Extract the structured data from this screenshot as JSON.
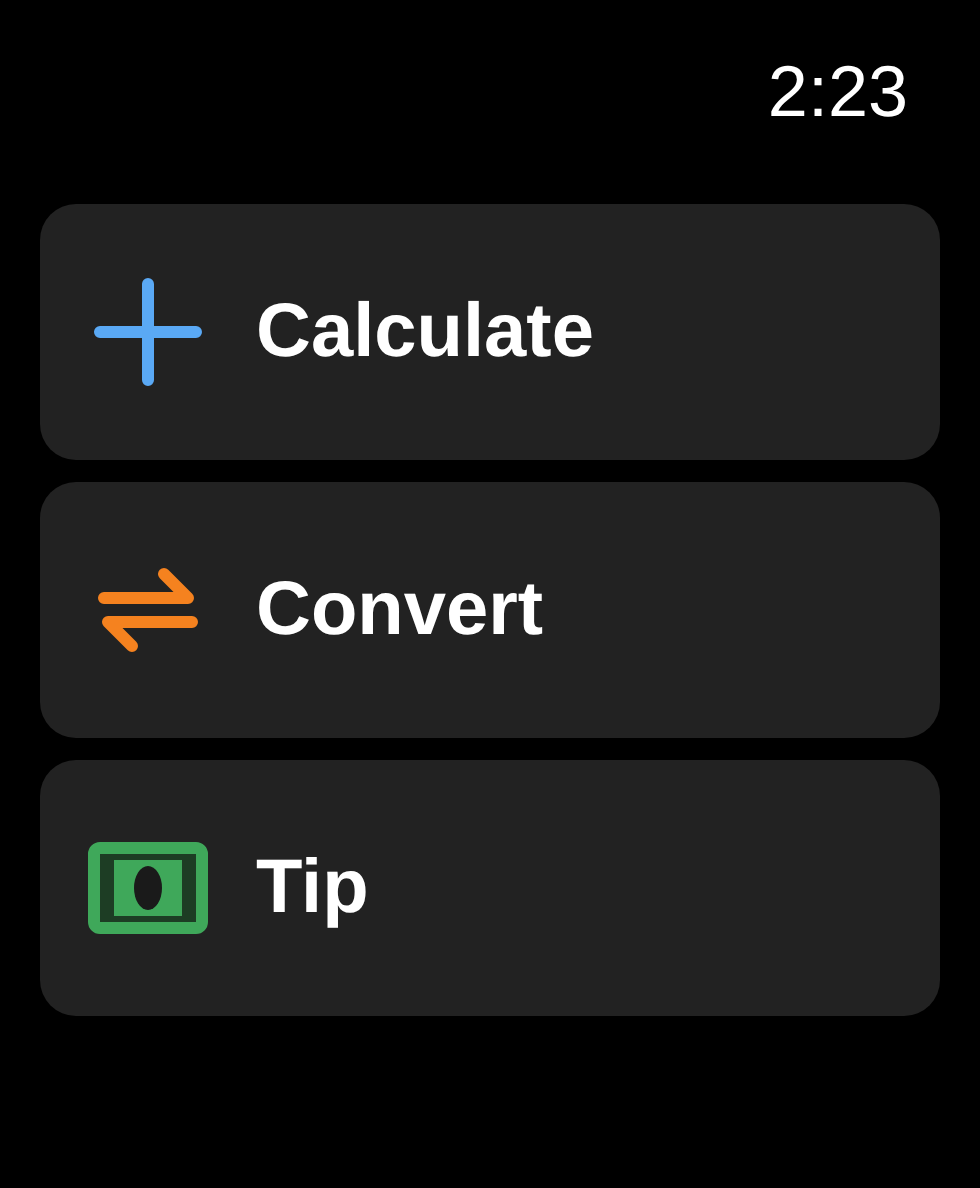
{
  "status_bar": {
    "time": "2:23"
  },
  "items": [
    {
      "label": "Calculate",
      "kind": "plus"
    },
    {
      "label": "Convert",
      "kind": "swap"
    },
    {
      "label": "Tip",
      "kind": "money"
    }
  ]
}
